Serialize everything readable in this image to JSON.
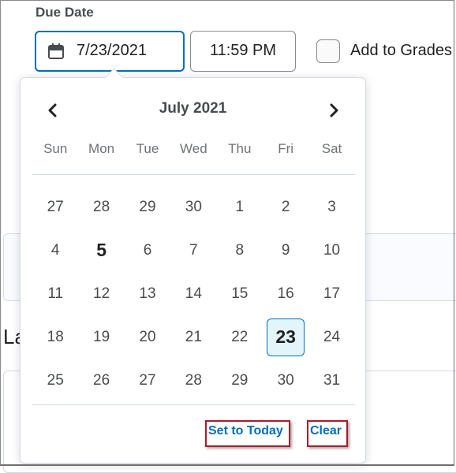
{
  "form": {
    "due_date_label": "Due Date",
    "date_value": "7/23/2021",
    "time_value": "11:59 PM",
    "add_to_grades_label": "Add to Grades",
    "add_to_grades_checked": false,
    "background_heading_fragment": "La"
  },
  "calendar": {
    "month_label": "July 2021",
    "prev_icon": "chevron-left-icon",
    "next_icon": "chevron-right-icon",
    "weekdays": [
      "Sun",
      "Mon",
      "Tue",
      "Wed",
      "Thu",
      "Fri",
      "Sat"
    ],
    "weeks": [
      [
        "27",
        "28",
        "29",
        "30",
        "1",
        "2",
        "3"
      ],
      [
        "4",
        "5",
        "6",
        "7",
        "8",
        "9",
        "10"
      ],
      [
        "11",
        "12",
        "13",
        "14",
        "15",
        "16",
        "17"
      ],
      [
        "18",
        "19",
        "20",
        "21",
        "22",
        "23",
        "24"
      ],
      [
        "25",
        "26",
        "27",
        "28",
        "29",
        "30",
        "31"
      ]
    ],
    "today": "5",
    "selected": "23",
    "set_to_today_label": "Set to Today",
    "clear_label": "Clear"
  },
  "colors": {
    "accent": "#006fbf",
    "selected_bg": "#e3f4fb",
    "highlight": "#b0182b"
  }
}
